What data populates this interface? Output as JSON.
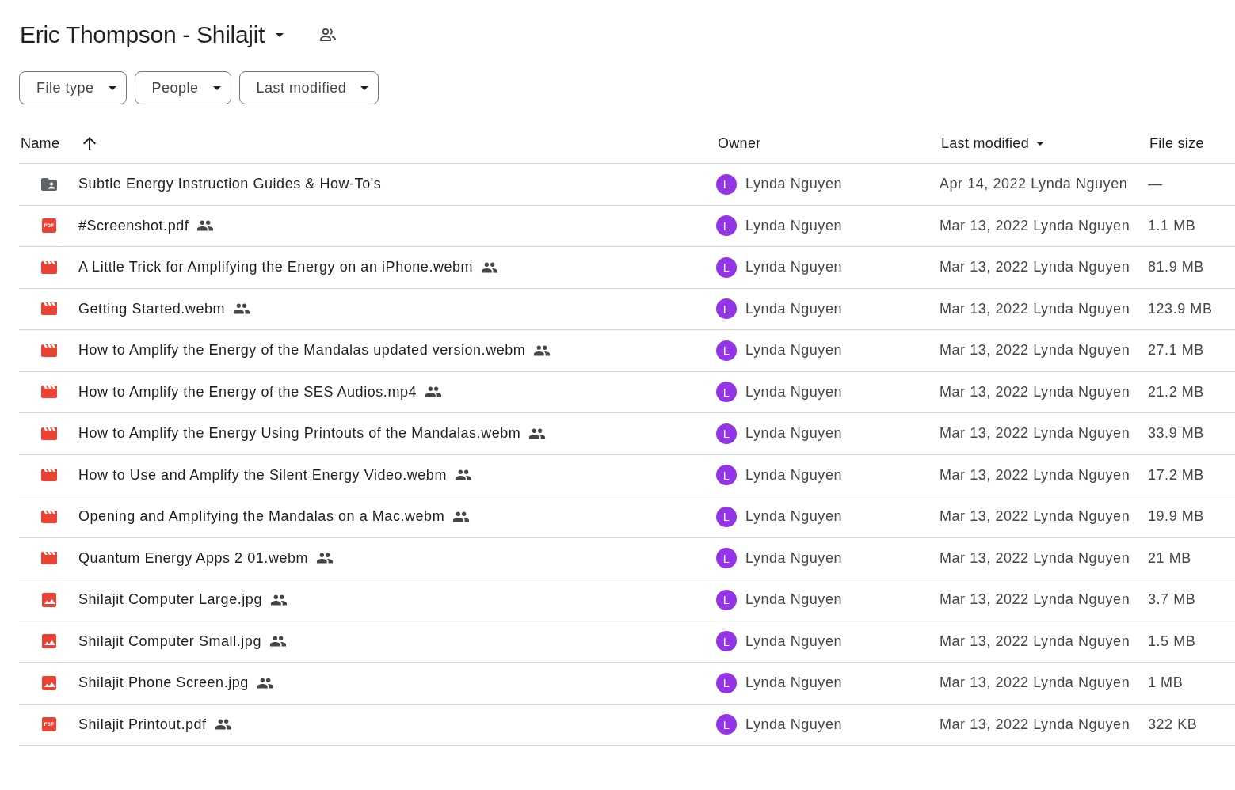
{
  "header": {
    "title": "Eric Thompson - Shilajit",
    "shared": true
  },
  "filters": [
    "File type",
    "People",
    "Last modified"
  ],
  "table": {
    "columns": [
      {
        "label": "Name",
        "sorted": true,
        "ascending": true
      },
      {
        "label": "Owner",
        "sorted": false
      },
      {
        "label": "Last modified",
        "sorted": true,
        "ascending": false
      },
      {
        "label": "File size",
        "sorted": false
      }
    ],
    "rows": [
      {
        "kind": "folder",
        "name": "Subtle Energy Instruction Guides & How-To's",
        "shared": false,
        "owner_initial": "L",
        "owner": "Lynda Nguyen",
        "modified": "Apr 14, 2022 Lynda Nguyen",
        "size": "—"
      },
      {
        "kind": "pdf",
        "name": "#Screenshot.pdf",
        "shared": true,
        "owner_initial": "L",
        "owner": "Lynda Nguyen",
        "modified": "Mar 13, 2022 Lynda Nguyen",
        "size": "1.1 MB"
      },
      {
        "kind": "video",
        "name": "A Little Trick for Amplifying the Energy on an iPhone.webm",
        "shared": true,
        "owner_initial": "L",
        "owner": "Lynda Nguyen",
        "modified": "Mar 13, 2022 Lynda Nguyen",
        "size": "81.9 MB"
      },
      {
        "kind": "video",
        "name": "Getting Started.webm",
        "shared": true,
        "owner_initial": "L",
        "owner": "Lynda Nguyen",
        "modified": "Mar 13, 2022 Lynda Nguyen",
        "size": "123.9 MB"
      },
      {
        "kind": "video",
        "name": "How to Amplify the Energy of the Mandalas updated version.webm",
        "shared": true,
        "owner_initial": "L",
        "owner": "Lynda Nguyen",
        "modified": "Mar 13, 2022 Lynda Nguyen",
        "size": "27.1 MB"
      },
      {
        "kind": "video",
        "name": "How to Amplify the Energy of the SES Audios.mp4",
        "shared": true,
        "owner_initial": "L",
        "owner": "Lynda Nguyen",
        "modified": "Mar 13, 2022 Lynda Nguyen",
        "size": "21.2 MB"
      },
      {
        "kind": "video",
        "name": "How to Amplify the Energy Using Printouts of the Mandalas.webm",
        "shared": true,
        "owner_initial": "L",
        "owner": "Lynda Nguyen",
        "modified": "Mar 13, 2022 Lynda Nguyen",
        "size": "33.9 MB"
      },
      {
        "kind": "video",
        "name": "How to Use and Amplify the Silent Energy Video.webm",
        "shared": true,
        "owner_initial": "L",
        "owner": "Lynda Nguyen",
        "modified": "Mar 13, 2022 Lynda Nguyen",
        "size": "17.2 MB"
      },
      {
        "kind": "video",
        "name": "Opening and Amplifying the Mandalas on a Mac.webm",
        "shared": true,
        "owner_initial": "L",
        "owner": "Lynda Nguyen",
        "modified": "Mar 13, 2022 Lynda Nguyen",
        "size": "19.9 MB"
      },
      {
        "kind": "video",
        "name": "Quantum Energy Apps 2 01.webm",
        "shared": true,
        "owner_initial": "L",
        "owner": "Lynda Nguyen",
        "modified": "Mar 13, 2022 Lynda Nguyen",
        "size": "21 MB"
      },
      {
        "kind": "image",
        "name": "Shilajit Computer Large.jpg",
        "shared": true,
        "owner_initial": "L",
        "owner": "Lynda Nguyen",
        "modified": "Mar 13, 2022 Lynda Nguyen",
        "size": "3.7 MB"
      },
      {
        "kind": "image",
        "name": "Shilajit Computer Small.jpg",
        "shared": true,
        "owner_initial": "L",
        "owner": "Lynda Nguyen",
        "modified": "Mar 13, 2022 Lynda Nguyen",
        "size": "1.5 MB"
      },
      {
        "kind": "image",
        "name": "Shilajit Phone Screen.jpg",
        "shared": true,
        "owner_initial": "L",
        "owner": "Lynda Nguyen",
        "modified": "Mar 13, 2022 Lynda Nguyen",
        "size": "1 MB"
      },
      {
        "kind": "pdf",
        "name": "Shilajit Printout.pdf",
        "shared": true,
        "owner_initial": "L",
        "owner": "Lynda Nguyen",
        "modified": "Mar 13, 2022 Lynda Nguyen",
        "size": "322 KB"
      }
    ]
  }
}
